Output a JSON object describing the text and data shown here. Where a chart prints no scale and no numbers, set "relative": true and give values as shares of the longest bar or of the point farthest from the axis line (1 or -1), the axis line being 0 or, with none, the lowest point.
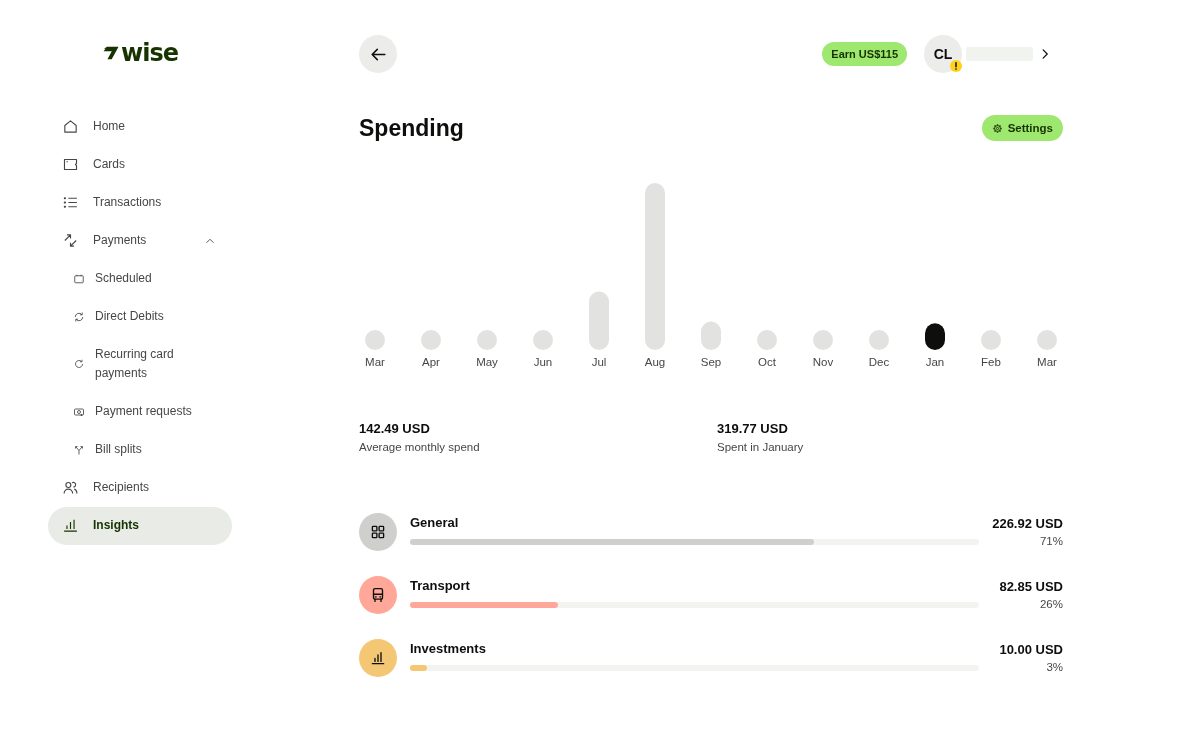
{
  "sidebar": {
    "logo": "wise",
    "items": [
      {
        "label": "Home",
        "selected": false
      },
      {
        "label": "Cards",
        "selected": false
      },
      {
        "label": "Transactions",
        "selected": false
      },
      {
        "label": "Payments",
        "selected": false,
        "expanded": true,
        "children": [
          {
            "label": "Scheduled",
            "selected": false
          },
          {
            "label": "Direct Debits",
            "selected": false
          },
          {
            "label": "Recurring card payments",
            "selected": false
          },
          {
            "label": "Payment requests",
            "selected": false
          },
          {
            "label": "Bill splits",
            "selected": false
          }
        ]
      },
      {
        "label": "Recipients",
        "selected": false
      },
      {
        "label": "Insights",
        "selected": true
      }
    ]
  },
  "header": {
    "promo_button": "Earn US$115",
    "profile": {
      "initials": "CL",
      "warning": true
    }
  },
  "spending": {
    "title": "Spending",
    "settings_button": "Settings",
    "chart_data": {
      "type": "bar",
      "relative": true,
      "categories": [
        "Mar",
        "Apr",
        "May",
        "Jun",
        "Jul",
        "Aug",
        "Sep",
        "Oct",
        "Nov",
        "Dec",
        "Jan",
        "Feb",
        "Mar"
      ],
      "series": [
        {
          "color": "#e2e2e1",
          "values": [
            0.12,
            0.12,
            0.12,
            0.12,
            0.35,
            1,
            0.17,
            0.12,
            0.12,
            0.12,
            null,
            0.12,
            0.12
          ]
        },
        {
          "color": "#0e0f0c",
          "values": [
            null,
            null,
            null,
            null,
            null,
            null,
            null,
            null,
            null,
            null,
            0.16,
            null,
            null
          ]
        }
      ]
    },
    "stats": [
      {
        "value": "142.49 USD",
        "label": "Average monthly spend"
      },
      {
        "value": "319.77 USD",
        "label": "Spent in January"
      }
    ],
    "categories": [
      {
        "name": "General",
        "kind": "grid",
        "color": "#cfd0cd",
        "level": 0.71,
        "amount": "226.92 USD",
        "share": "71%"
      },
      {
        "name": "Transport",
        "kind": "bus",
        "color": "#ffa899",
        "level": 0.26,
        "amount": "82.85 USD",
        "share": "26%"
      },
      {
        "name": "Investments",
        "kind": "bars",
        "color": "#f4c774",
        "level": 0.03,
        "amount": "10.00 USD",
        "share": "3%"
      }
    ]
  }
}
